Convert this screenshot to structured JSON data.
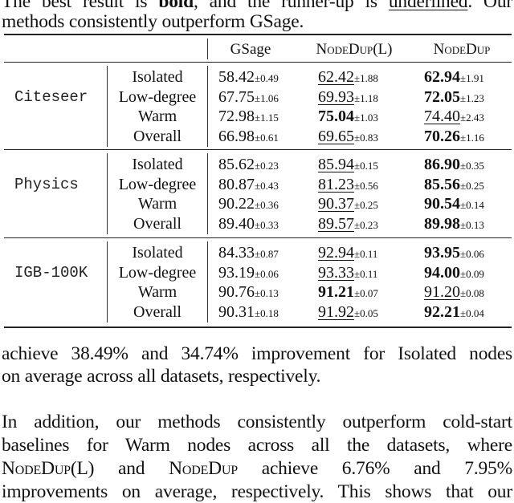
{
  "caption": {
    "line1_parts": [
      "The best result is ",
      "bold",
      ", and the runner-up is ",
      "underlined",
      ".  Our"
    ],
    "line2": "methods consistently outperform GSage."
  },
  "table": {
    "columns": [
      "GSage",
      "NodeDup(L)",
      "NodeDup"
    ],
    "groups": [
      {
        "dataset": "Citeseer",
        "rows": [
          {
            "label": "Isolated",
            "cells": [
              {
                "v": "58.42",
                "s": "±0.49",
                "style": ""
              },
              {
                "v": "62.42",
                "s": "±1.88",
                "style": "u"
              },
              {
                "v": "62.94",
                "s": "±1.91",
                "style": "b"
              }
            ]
          },
          {
            "label": "Low-degree",
            "cells": [
              {
                "v": "67.75",
                "s": "±1.06",
                "style": ""
              },
              {
                "v": "69.93",
                "s": "±1.18",
                "style": "u"
              },
              {
                "v": "72.05",
                "s": "±1.23",
                "style": "b"
              }
            ]
          },
          {
            "label": "Warm",
            "cells": [
              {
                "v": "72.98",
                "s": "±1.15",
                "style": ""
              },
              {
                "v": "75.04",
                "s": "±1.03",
                "style": "b"
              },
              {
                "v": "74.40",
                "s": "±2.43",
                "style": "u"
              }
            ]
          },
          {
            "label": "Overall",
            "cells": [
              {
                "v": "66.98",
                "s": "±0.61",
                "style": ""
              },
              {
                "v": "69.65",
                "s": "±0.83",
                "style": "u"
              },
              {
                "v": "70.26",
                "s": "±1.16",
                "style": "b"
              }
            ]
          }
        ]
      },
      {
        "dataset": "Physics",
        "rows": [
          {
            "label": "Isolated",
            "cells": [
              {
                "v": "85.62",
                "s": "±0.23",
                "style": ""
              },
              {
                "v": "85.94",
                "s": "±0.15",
                "style": "u"
              },
              {
                "v": "86.90",
                "s": "±0.35",
                "style": "b"
              }
            ]
          },
          {
            "label": "Low-degree",
            "cells": [
              {
                "v": "80.87",
                "s": "±0.43",
                "style": ""
              },
              {
                "v": "81.23",
                "s": "±0.56",
                "style": "u"
              },
              {
                "v": "85.56",
                "s": "±0.25",
                "style": "b"
              }
            ]
          },
          {
            "label": "Warm",
            "cells": [
              {
                "v": "90.22",
                "s": "±0.36",
                "style": ""
              },
              {
                "v": "90.37",
                "s": "±0.25",
                "style": "u"
              },
              {
                "v": "90.54",
                "s": "±0.14",
                "style": "b"
              }
            ]
          },
          {
            "label": "Overall",
            "cells": [
              {
                "v": "89.40",
                "s": "±0.33",
                "style": ""
              },
              {
                "v": "89.57",
                "s": "±0.23",
                "style": "u"
              },
              {
                "v": "89.98",
                "s": "±0.13",
                "style": "b"
              }
            ]
          }
        ]
      },
      {
        "dataset": "IGB-100K",
        "rows": [
          {
            "label": "Isolated",
            "cells": [
              {
                "v": "84.33",
                "s": "±0.87",
                "style": ""
              },
              {
                "v": "92.94",
                "s": "±0.11",
                "style": "u"
              },
              {
                "v": "93.95",
                "s": "±0.06",
                "style": "b"
              }
            ]
          },
          {
            "label": "Low-degree",
            "cells": [
              {
                "v": "93.19",
                "s": "±0.06",
                "style": ""
              },
              {
                "v": "93.33",
                "s": "±0.11",
                "style": "u"
              },
              {
                "v": "94.00",
                "s": "±0.09",
                "style": "b"
              }
            ]
          },
          {
            "label": "Warm",
            "cells": [
              {
                "v": "90.76",
                "s": "±0.13",
                "style": ""
              },
              {
                "v": "91.21",
                "s": "±0.07",
                "style": "b"
              },
              {
                "v": "91.20",
                "s": "±0.08",
                "style": "u"
              }
            ]
          },
          {
            "label": "Overall",
            "cells": [
              {
                "v": "90.31",
                "s": "±0.18",
                "style": ""
              },
              {
                "v": "91.92",
                "s": "±0.05",
                "style": "u"
              },
              {
                "v": "92.21",
                "s": "±0.04",
                "style": "b"
              }
            ]
          }
        ]
      }
    ]
  },
  "body": {
    "p1_line1": "achieve 38.49% and 34.74% improvement for Isolated nodes",
    "p1_line2": "on average across all datasets, respectively.",
    "p2_line1": "In addition, our methods consistently outperform cold-start",
    "p2_line2": "baselines for Warm nodes across all the datasets, where",
    "p2_line3_parts": [
      "NodeDup(L)",
      " and ",
      "NodeDup",
      " achieve 6.76% and 7.95%"
    ],
    "p2_line4": "improvements on average, respectively. This shows that our"
  }
}
